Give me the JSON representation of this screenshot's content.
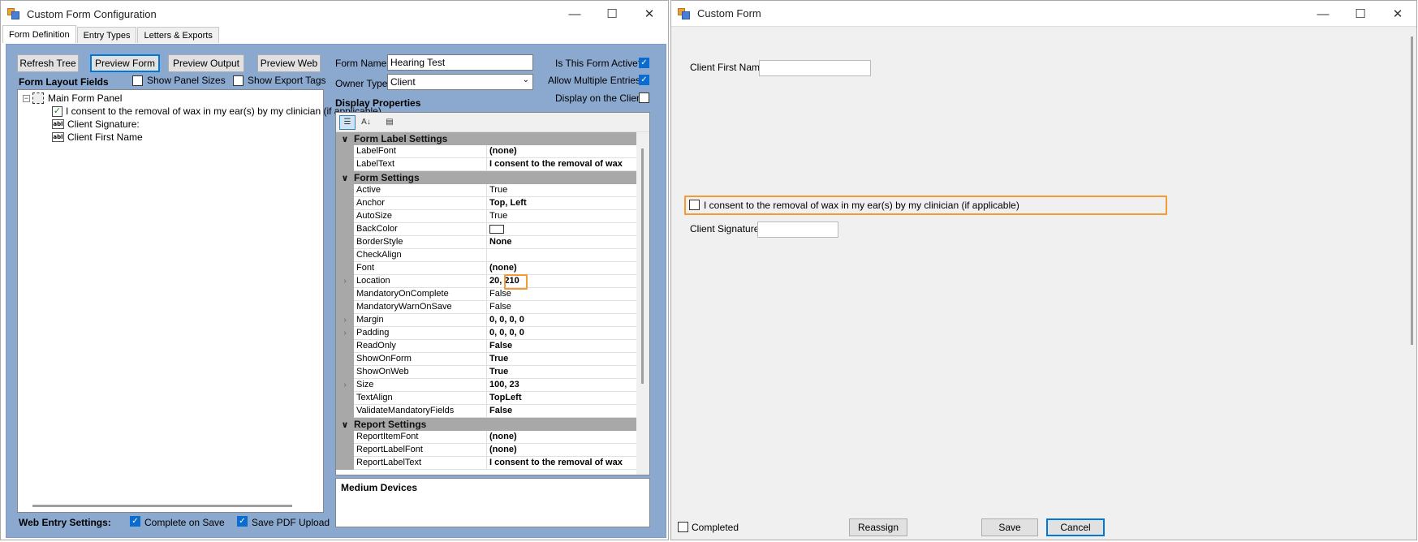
{
  "config_window": {
    "title": "Custom Form Configuration",
    "tabs": [
      "Form Definition",
      "Entry Types",
      "Letters & Exports"
    ],
    "toolbar": {
      "refresh_tree": "Refresh Tree",
      "preview_form": "Preview Form",
      "preview_output": "Preview Output",
      "preview_web": "Preview Web"
    },
    "show_panel_sizes": "Show Panel Sizes",
    "show_export_tags": "Show Export Tags",
    "form_layout_fields": "Form Layout Fields",
    "tree": {
      "root": "Main Form Panel",
      "items": [
        "I consent to the removal of wax in my ear(s) by my clinician (if applicable)",
        "Client Signature:",
        "Client First Name"
      ]
    },
    "form_name_label": "Form Name",
    "form_name_value": "Hearing Test",
    "owner_type_label": "Owner Type",
    "owner_type_value": "Client",
    "is_active_label": "Is This Form Active?",
    "allow_multiple_label": "Allow Multiple Entries?",
    "display_on_client_label": "Display on the Client",
    "display_properties": "Display Properties",
    "web_entry_settings": "Web Entry Settings:",
    "complete_on_save": "Complete on Save",
    "save_pdf_upload": "Save PDF Upload",
    "description_title": "Medium Devices",
    "property_grid": {
      "categories": [
        {
          "name": "Form Label Settings",
          "rows": [
            {
              "name": "LabelFont",
              "value": "(none)",
              "bold": true
            },
            {
              "name": "LabelText",
              "value": "I consent to the removal of wax",
              "bold": true
            }
          ]
        },
        {
          "name": "Form Settings",
          "rows": [
            {
              "name": "Active",
              "value": "True",
              "bold": false
            },
            {
              "name": "Anchor",
              "value": "Top, Left",
              "bold": true
            },
            {
              "name": "AutoSize",
              "value": "True",
              "bold": false
            },
            {
              "name": "BackColor",
              "value": "",
              "bold": false
            },
            {
              "name": "BorderStyle",
              "value": "None",
              "bold": true
            },
            {
              "name": "CheckAlign",
              "value": "",
              "bold": false
            },
            {
              "name": "Font",
              "value": "(none)",
              "bold": true
            },
            {
              "name": "Location",
              "value": "20, 210",
              "bold": true
            },
            {
              "name": "MandatoryOnComplete",
              "value": "False",
              "bold": false
            },
            {
              "name": "MandatoryWarnOnSave",
              "value": "False",
              "bold": false
            },
            {
              "name": "Margin",
              "value": "0, 0, 0, 0",
              "bold": true
            },
            {
              "name": "Padding",
              "value": "0, 0, 0, 0",
              "bold": true
            },
            {
              "name": "ReadOnly",
              "value": "False",
              "bold": true
            },
            {
              "name": "ShowOnForm",
              "value": "True",
              "bold": true
            },
            {
              "name": "ShowOnWeb",
              "value": "True",
              "bold": true
            },
            {
              "name": "Size",
              "value": "100, 23",
              "bold": true
            },
            {
              "name": "TextAlign",
              "value": "TopLeft",
              "bold": true
            },
            {
              "name": "ValidateMandatoryFields",
              "value": "False",
              "bold": true
            }
          ]
        },
        {
          "name": "Report Settings",
          "rows": [
            {
              "name": "ReportItemFont",
              "value": "(none)",
              "bold": true
            },
            {
              "name": "ReportLabelFont",
              "value": "(none)",
              "bold": true
            },
            {
              "name": "ReportLabelText",
              "value": "I consent to the removal of wax",
              "bold": true
            }
          ]
        }
      ]
    }
  },
  "form_window": {
    "title": "Custom Form",
    "client_first_name_label": "Client First Name",
    "consent_label": "I consent to the removal of wax in my ear(s) by my clinician (if applicable)",
    "client_signature_label": "Client Signature:",
    "completed_label": "Completed",
    "reassign": "Reassign",
    "save": "Save",
    "cancel": "Cancel"
  },
  "colors": {
    "panel_blue": "#8ba8cf",
    "highlight_orange": "#f39b34",
    "checkbox_blue": "#0a6ccf"
  }
}
